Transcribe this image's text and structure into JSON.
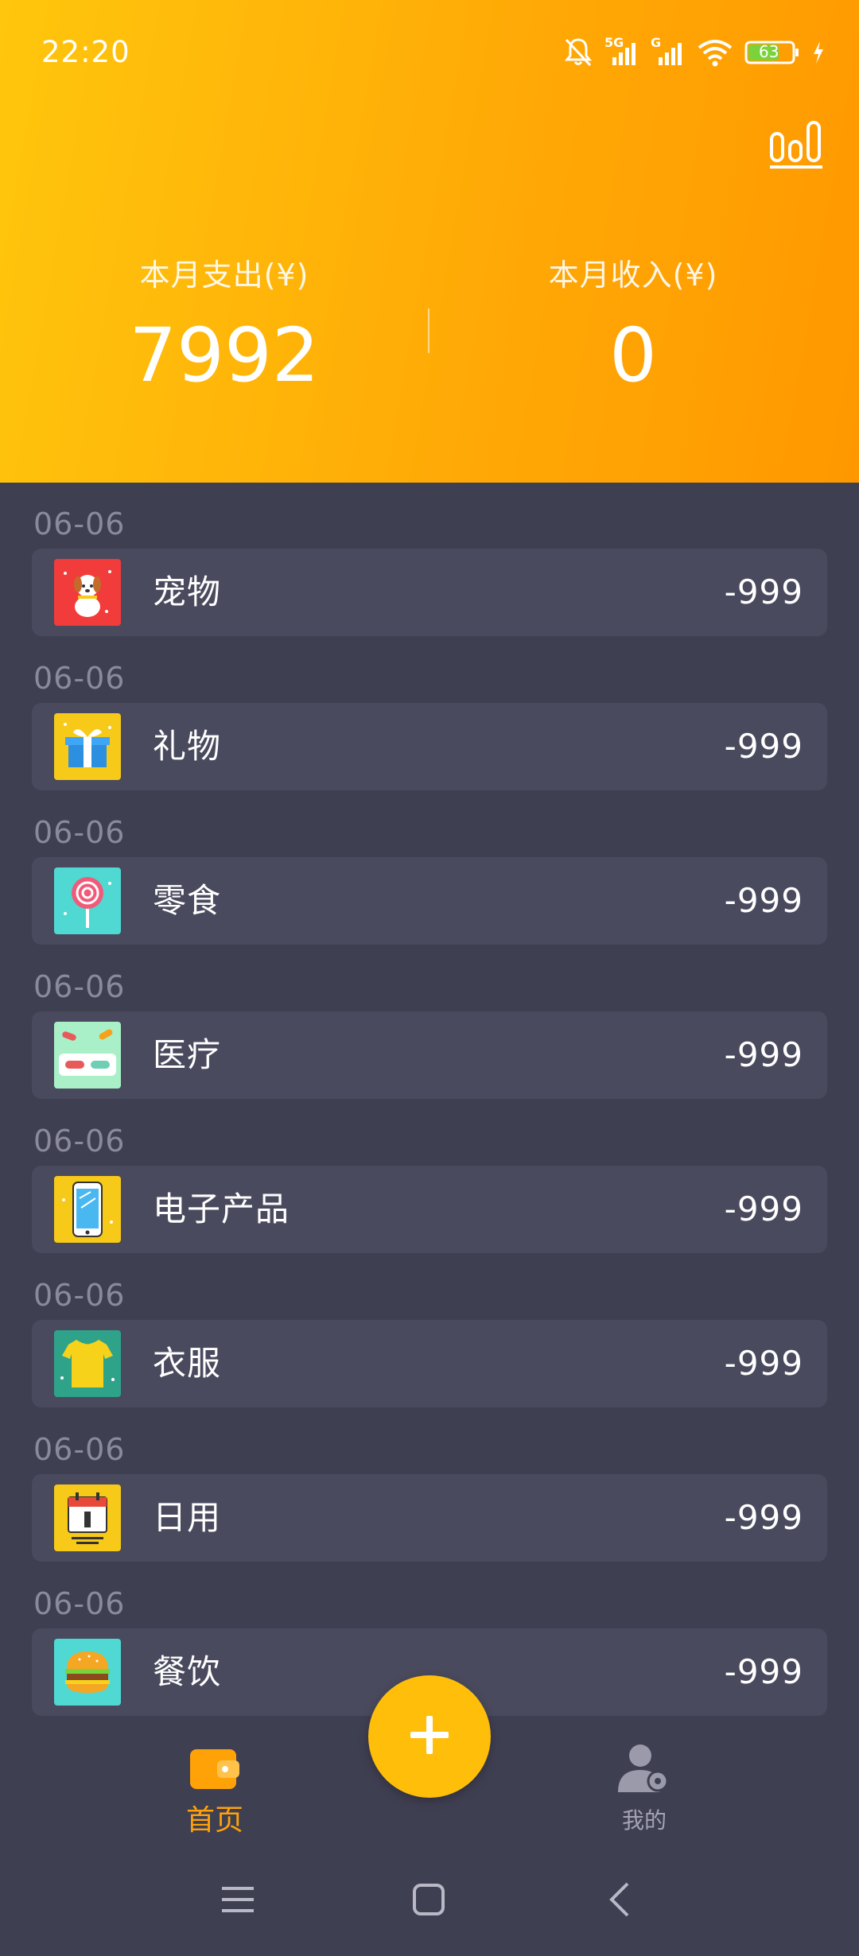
{
  "status_bar": {
    "time": "22:20",
    "network_1": "5G",
    "network_2": "G",
    "battery": "63",
    "icons": [
      "bell-muted-icon",
      "signal-icon",
      "signal-icon",
      "wifi-icon",
      "battery-icon",
      "charging-icon"
    ]
  },
  "header": {
    "stats_icon": "bar-chart-icon",
    "expense_label": "本月支出(¥)",
    "expense_value": "7992",
    "income_label": "本月收入(¥)",
    "income_value": "0"
  },
  "records": [
    {
      "date": "06-06",
      "category": "宠物",
      "amount": "-999",
      "icon": "pet-dog-icon",
      "icon_bg": "#f23b3b"
    },
    {
      "date": "06-06",
      "category": "礼物",
      "amount": "-999",
      "icon": "gift-box-icon",
      "icon_bg": "#f7c918"
    },
    {
      "date": "06-06",
      "category": "零食",
      "amount": "-999",
      "icon": "lollipop-icon",
      "icon_bg": "#4fd9d2"
    },
    {
      "date": "06-06",
      "category": "医疗",
      "amount": "-999",
      "icon": "medicine-pill-icon",
      "icon_bg": "#a9f0c8"
    },
    {
      "date": "06-06",
      "category": "电子产品",
      "amount": "-999",
      "icon": "smartphone-icon",
      "icon_bg": "#f7c918"
    },
    {
      "date": "06-06",
      "category": "衣服",
      "amount": "-999",
      "icon": "tshirt-icon",
      "icon_bg": "#2fa38a"
    },
    {
      "date": "06-06",
      "category": "日用",
      "amount": "-999",
      "icon": "calendar-icon",
      "icon_bg": "#f7c918"
    },
    {
      "date": "06-06",
      "category": "餐饮",
      "amount": "-999",
      "icon": "burger-icon",
      "icon_bg": "#4fd9d2"
    }
  ],
  "bottom_nav": {
    "home_label": "首页",
    "mine_label": "我的",
    "add_icon": "plus-icon"
  },
  "colors": {
    "header_gradient_start": "#ffc60d",
    "header_gradient_end": "#ff9800",
    "background": "#3f3f52",
    "card": "#4a4a5e",
    "accent": "#ffa208"
  }
}
